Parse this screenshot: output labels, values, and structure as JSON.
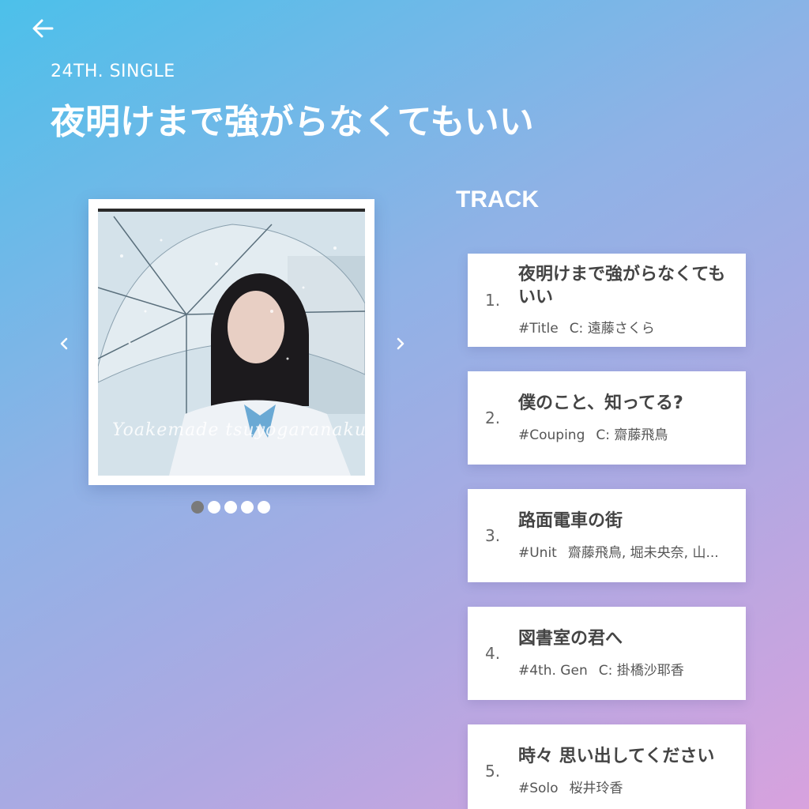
{
  "header": {
    "back_icon": "arrow-left-icon",
    "subtitle": "24TH. SINGLE",
    "title": "夜明けまで強がらなくてもいい"
  },
  "carousel": {
    "cover_script_text": "Yoakemade tsuyogaranakutemoii",
    "prev_icon": "chevron-left-icon",
    "next_icon": "chevron-right-icon",
    "page_count": 5,
    "active_index": 0
  },
  "tracks": {
    "heading": "TRACK",
    "items": [
      {
        "num": "1.",
        "title": "夜明けまで強がらなくてもいい",
        "tag": "#Title",
        "center": "C: 遠藤さくら"
      },
      {
        "num": "2.",
        "title": "僕のこと、知ってる?",
        "tag": "#Couping",
        "center": "C: 齋藤飛鳥"
      },
      {
        "num": "3.",
        "title": "路面電車の街",
        "tag": "#Unit",
        "center": "齋藤飛鳥, 堀未央奈, 山..."
      },
      {
        "num": "4.",
        "title": "図書室の君へ",
        "tag": "#4th. Gen",
        "center": "C: 掛橋沙耶香"
      },
      {
        "num": "5.",
        "title": "時々 思い出してください",
        "tag": "#Solo",
        "center": "桜井玲香"
      }
    ]
  },
  "colors": {
    "gradient_start": "#4cc0ea",
    "gradient_end": "#d8a2de",
    "active_dot": "#7a7a7a"
  }
}
